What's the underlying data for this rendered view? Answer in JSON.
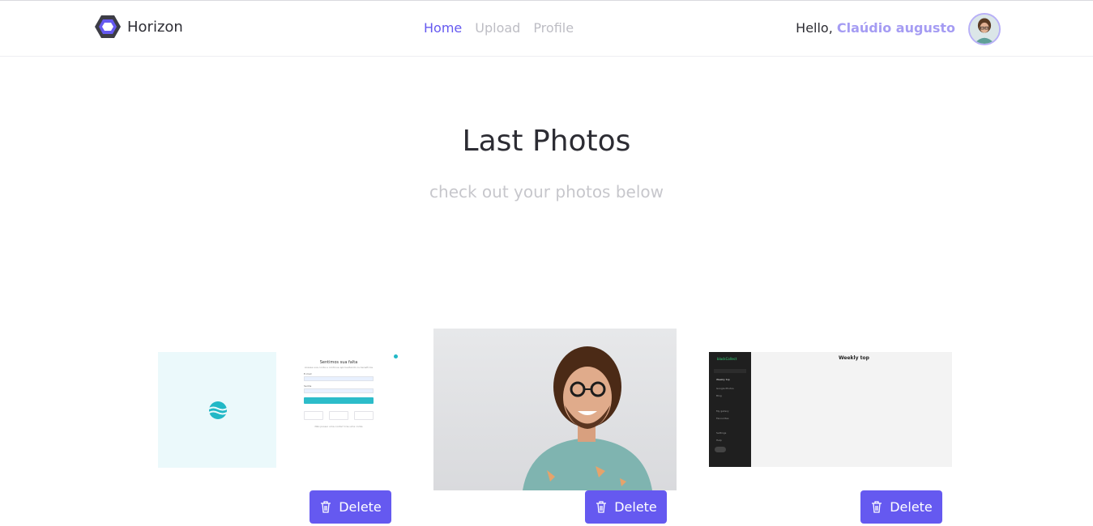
{
  "header": {
    "brand": "Horizon",
    "nav": [
      {
        "label": "Home",
        "active": true
      },
      {
        "label": "Upload",
        "active": false
      },
      {
        "label": "Profile",
        "active": false
      }
    ],
    "greeting": "Hello,",
    "user_name": "Claúdio augusto"
  },
  "main": {
    "title": "Last Photos",
    "subtitle": "check out your photos below"
  },
  "photos": [
    {
      "delete_label": "Delete",
      "preview": {
        "title": "Sentimos sua falta",
        "subtitle": "Acesse sua conta e continue aproveitando os benefícios",
        "email_label": "E-mail",
        "password_label": "Senha",
        "submit_label": "Entrar",
        "footer": "Não possui uma conta? Crie uma conta"
      }
    },
    {
      "delete_label": "Delete"
    },
    {
      "delete_label": "Delete",
      "preview": {
        "brand": "blackCollect",
        "page_title": "Weekly top",
        "sidebar_items": [
          "Weekly top",
          "Google Photos",
          "Blog",
          "My gallery",
          "Favourites",
          "Settings",
          "Help"
        ]
      }
    }
  ],
  "colors": {
    "accent": "#6559f0",
    "accent_light": "#a59cf3",
    "muted": "#c7c7cc"
  }
}
